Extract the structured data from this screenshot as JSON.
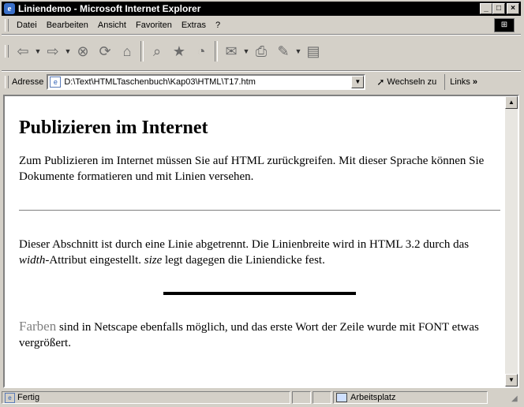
{
  "window": {
    "title": "Liniendemo - Microsoft Internet Explorer",
    "controls": {
      "minimize": "_",
      "maximize": "□",
      "close": "×"
    }
  },
  "menubar": {
    "items": [
      {
        "label": "Datei"
      },
      {
        "label": "Bearbeiten"
      },
      {
        "label": "Ansicht"
      },
      {
        "label": "Favoriten"
      },
      {
        "label": "Extras"
      },
      {
        "label": "?"
      }
    ]
  },
  "toolbar": {
    "icons": [
      "back-icon",
      "forward-icon",
      "stop-icon",
      "refresh-icon",
      "home-icon",
      "search-icon",
      "favorites-icon",
      "history-icon",
      "mail-icon",
      "print-icon",
      "edit-icon",
      "discuss-icon"
    ]
  },
  "addressbar": {
    "label": "Adresse",
    "value": "D:\\Text\\HTMLTaschenbuch\\Kap03\\HTML\\T17.htm",
    "go_label": "Wechseln zu",
    "links_label": "Links"
  },
  "page": {
    "heading": "Publizieren im Internet",
    "para1": "Zum Publizieren im Internet müssen Sie auf HTML zurückgreifen. Mit dieser Sprache können Sie Dokumente formatieren und mit Linien versehen.",
    "para2_a": "Dieser Abschnitt ist durch eine Linie abgetrennt. Die Linienbreite wird in HTML 3.2 durch das ",
    "para2_width": "width",
    "para2_b": "-Attribut eingestellt. ",
    "para2_size": "size",
    "para2_c": " legt dagegen die Liniendicke fest.",
    "para3_word": "Farben",
    "para3_rest": " sind in Netscape ebenfalls möglich, und das erste Wort der Zeile wurde mit FONT etwas vergrößert."
  },
  "statusbar": {
    "status": "Fertig",
    "zone": "Arbeitsplatz"
  }
}
